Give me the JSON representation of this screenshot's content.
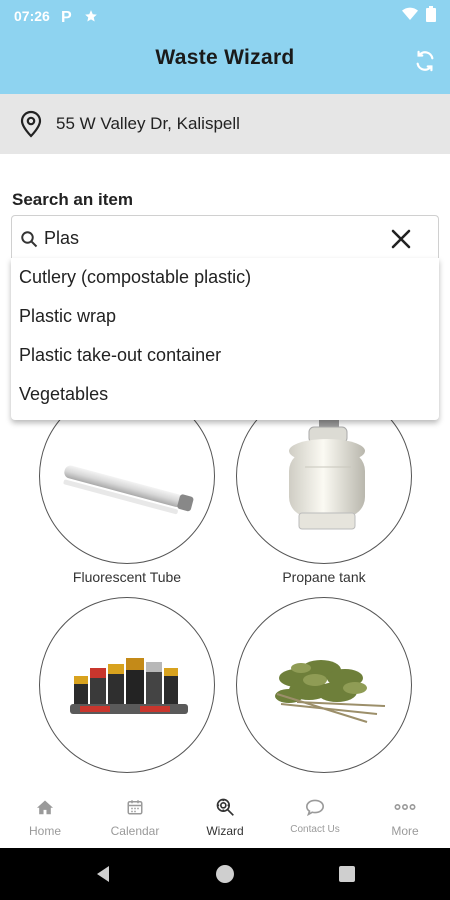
{
  "status_bar": {
    "time": "07:26"
  },
  "app": {
    "title": "Waste Wizard"
  },
  "location": {
    "address": "55 W Valley Dr, Kalispell"
  },
  "search": {
    "label": "Search an item",
    "value": "Plas",
    "suggestions": [
      "Cutlery (compostable plastic)",
      "Plastic wrap",
      "Plastic take-out container",
      "Vegetables"
    ]
  },
  "items": [
    {
      "label": "Fluorescent Tube",
      "icon": "fluorescent-tube-image"
    },
    {
      "label": "Propane tank",
      "icon": "propane-tank-image"
    },
    {
      "label": "",
      "icon": "batteries-image"
    },
    {
      "label": "",
      "icon": "yard-waste-image"
    }
  ],
  "nav": {
    "items": [
      {
        "label": "Home",
        "icon": "home-icon"
      },
      {
        "label": "Calendar",
        "icon": "calendar-icon"
      },
      {
        "label": "Wizard",
        "icon": "wizard-icon",
        "active": true
      },
      {
        "label": "Contact Us",
        "icon": "chat-icon"
      },
      {
        "label": "More",
        "icon": "more-icon"
      }
    ]
  },
  "colors": {
    "header": "#8ed3f0",
    "location_bar": "#e6e6e6",
    "system_nav": "#000000"
  }
}
